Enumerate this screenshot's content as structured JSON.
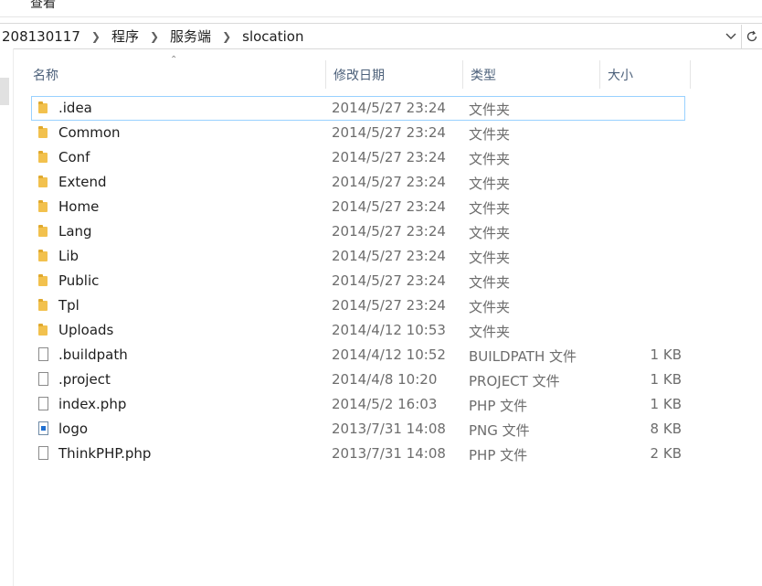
{
  "menu": {
    "view_label": "查看"
  },
  "breadcrumb": {
    "items": [
      "208130117",
      "程序",
      "服务端",
      "slocation"
    ]
  },
  "columns": {
    "name": "名称",
    "date": "修改日期",
    "type": "类型",
    "size": "大小"
  },
  "files": [
    {
      "name": ".idea",
      "date": "2014/5/27 23:24",
      "type": "文件夹",
      "size": "",
      "icon": "folder-icon",
      "focused": true
    },
    {
      "name": "Common",
      "date": "2014/5/27 23:24",
      "type": "文件夹",
      "size": "",
      "icon": "folder-icon"
    },
    {
      "name": "Conf",
      "date": "2014/5/27 23:24",
      "type": "文件夹",
      "size": "",
      "icon": "folder-icon"
    },
    {
      "name": "Extend",
      "date": "2014/5/27 23:24",
      "type": "文件夹",
      "size": "",
      "icon": "folder-icon"
    },
    {
      "name": "Home",
      "date": "2014/5/27 23:24",
      "type": "文件夹",
      "size": "",
      "icon": "folder-icon"
    },
    {
      "name": "Lang",
      "date": "2014/5/27 23:24",
      "type": "文件夹",
      "size": "",
      "icon": "folder-icon"
    },
    {
      "name": "Lib",
      "date": "2014/5/27 23:24",
      "type": "文件夹",
      "size": "",
      "icon": "folder-icon"
    },
    {
      "name": "Public",
      "date": "2014/5/27 23:24",
      "type": "文件夹",
      "size": "",
      "icon": "folder-icon"
    },
    {
      "name": "Tpl",
      "date": "2014/5/27 23:24",
      "type": "文件夹",
      "size": "",
      "icon": "folder-icon"
    },
    {
      "name": "Uploads",
      "date": "2014/4/12 10:53",
      "type": "文件夹",
      "size": "",
      "icon": "folder-icon"
    },
    {
      "name": ".buildpath",
      "date": "2014/4/12 10:52",
      "type": "BUILDPATH 文件",
      "size": "1 KB",
      "icon": "file-icon"
    },
    {
      "name": ".project",
      "date": "2014/4/8 10:20",
      "type": "PROJECT 文件",
      "size": "1 KB",
      "icon": "file-icon"
    },
    {
      "name": "index.php",
      "date": "2014/5/2 16:03",
      "type": "PHP 文件",
      "size": "1 KB",
      "icon": "file-icon"
    },
    {
      "name": "logo",
      "date": "2013/7/31 14:08",
      "type": "PNG 文件",
      "size": "8 KB",
      "icon": "image-icon"
    },
    {
      "name": "ThinkPHP.php",
      "date": "2013/7/31 14:08",
      "type": "PHP 文件",
      "size": "2 KB",
      "icon": "file-icon"
    }
  ],
  "colors": {
    "header_text": "#4c607a",
    "focus_outline": "#99d1ff",
    "folder": "#f2c14e"
  }
}
